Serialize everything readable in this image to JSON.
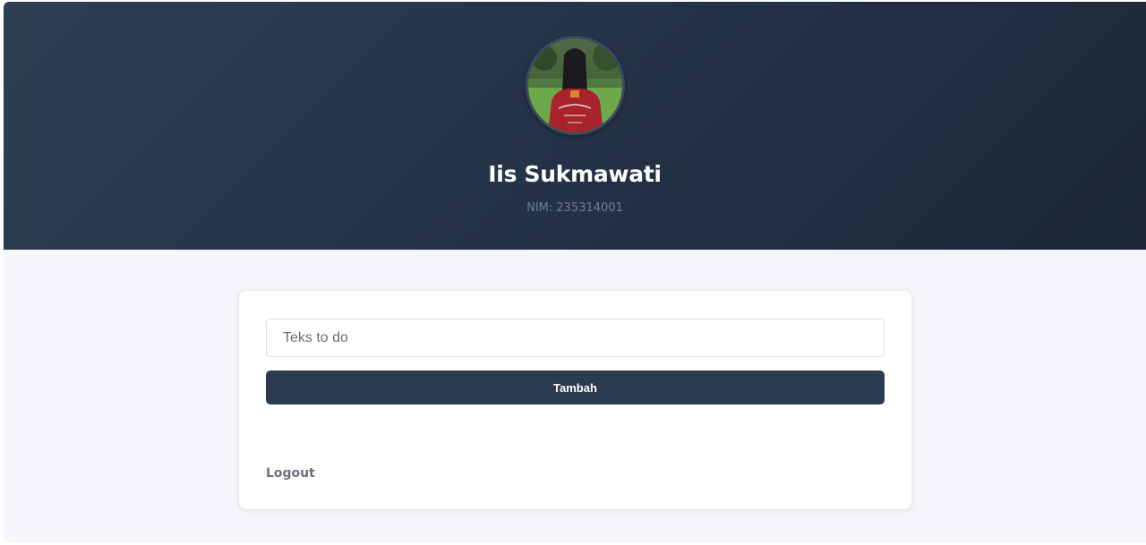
{
  "profile": {
    "name": "Iis Sukmawati",
    "nim": "NIM: 235314001"
  },
  "todo_form": {
    "input_placeholder": "Teks to do",
    "input_value": "",
    "add_button_label": "Tambah"
  },
  "footer": {
    "logout_label": "Logout"
  },
  "colors": {
    "header_bg": "#263448",
    "button_bg": "#2d3b4f",
    "page_bg": "#f4f6f9",
    "card_bg": "#ffffff"
  }
}
